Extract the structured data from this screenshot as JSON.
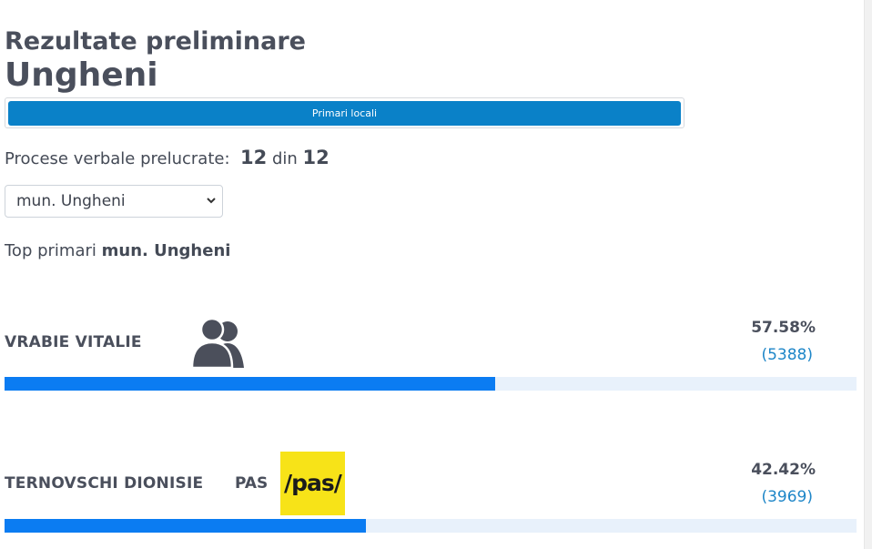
{
  "header": {
    "title": "Rezultate preliminare",
    "region": "Ungheni"
  },
  "tabs": {
    "active_label": "Primari locali"
  },
  "progress": {
    "label": "Procese verbale prelucrate:",
    "processed": "12",
    "separator": "din",
    "total": "12"
  },
  "locality_select": {
    "selected": "mun. Ungheni"
  },
  "top_heading": {
    "prefix": "Top primari",
    "locality": "mun. Ungheni"
  },
  "candidates": [
    {
      "name": "VRABIE VITALIE",
      "party": "",
      "icon": "people-icon",
      "percent_label": "57.58%",
      "votes_label": "(5388)",
      "percent": 57.58
    },
    {
      "name": "TERNOVSCHI DIONISIE",
      "party": "PAS",
      "logo_text": "/pas/",
      "percent_label": "42.42%",
      "votes_label": "(3969)",
      "percent": 42.42
    }
  ],
  "colors": {
    "accent": "#0a81c8",
    "bar_fill": "#0b7cf2",
    "bar_track": "#e8f1fb",
    "votes_link": "#1e86c8",
    "pas_yellow": "#f7e318"
  }
}
